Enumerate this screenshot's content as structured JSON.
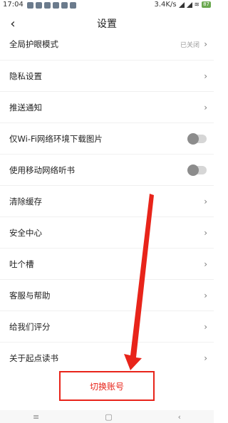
{
  "status_bar": {
    "time": "17:04",
    "network_speed": "3.4K/s",
    "battery": "87",
    "app_icons": [
      "app-icon",
      "app-icon",
      "app-icon",
      "app-icon",
      "app-icon",
      "app-icon"
    ]
  },
  "header": {
    "back_icon": "‹",
    "title": "设置"
  },
  "settings": [
    {
      "label": "全局护眼模式",
      "value": "已关闭",
      "control": "chevron"
    },
    {
      "label": "隐私设置",
      "control": "chevron"
    },
    {
      "label": "推送通知",
      "control": "chevron"
    },
    {
      "label": "仅Wi-Fi网络环境下载图片",
      "control": "toggle",
      "on": false
    },
    {
      "label": "使用移动网络听书",
      "control": "toggle",
      "on": false
    },
    {
      "label": "清除缓存",
      "control": "chevron"
    },
    {
      "label": "安全中心",
      "control": "chevron"
    },
    {
      "label": "吐个槽",
      "control": "chevron"
    },
    {
      "label": "客服与帮助",
      "control": "chevron"
    },
    {
      "label": "给我们评分",
      "control": "chevron"
    },
    {
      "label": "关于起点读书",
      "control": "chevron"
    }
  ],
  "switch_account_label": "切换账号",
  "accent_color": "#e8241a",
  "system_nav": {
    "menu_icon": "≡",
    "home_icon": "▢",
    "back_icon": "‹"
  }
}
